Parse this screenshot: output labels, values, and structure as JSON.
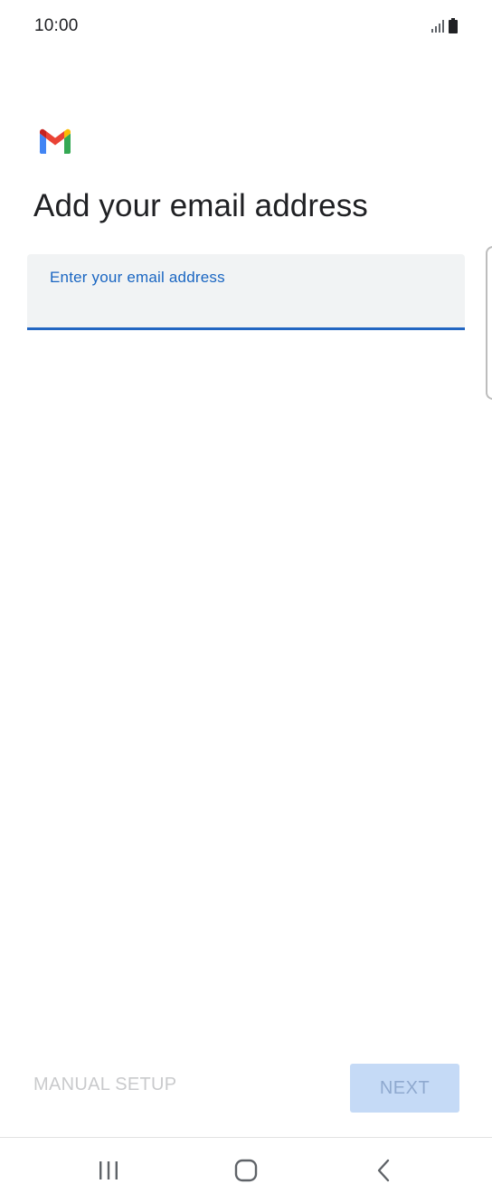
{
  "status_bar": {
    "time": "10:00",
    "signal_icon": "signal-icon",
    "battery_icon": "battery-icon"
  },
  "logo": {
    "icon": "gmail-logo-icon"
  },
  "page": {
    "title": "Add your email address"
  },
  "email_field": {
    "label": "Enter your email address",
    "value": ""
  },
  "actions": {
    "manual_setup_label": "MANUAL SETUP",
    "next_label": "NEXT"
  },
  "nav_bar": {
    "recents_icon": "recents-icon",
    "home_icon": "home-icon",
    "back_icon": "back-icon"
  },
  "colors": {
    "accent": "#1a66c2",
    "field_background": "#f1f3f4",
    "next_disabled_bg": "#c5daf6",
    "manual_setup_disabled": "#c9cacc"
  }
}
